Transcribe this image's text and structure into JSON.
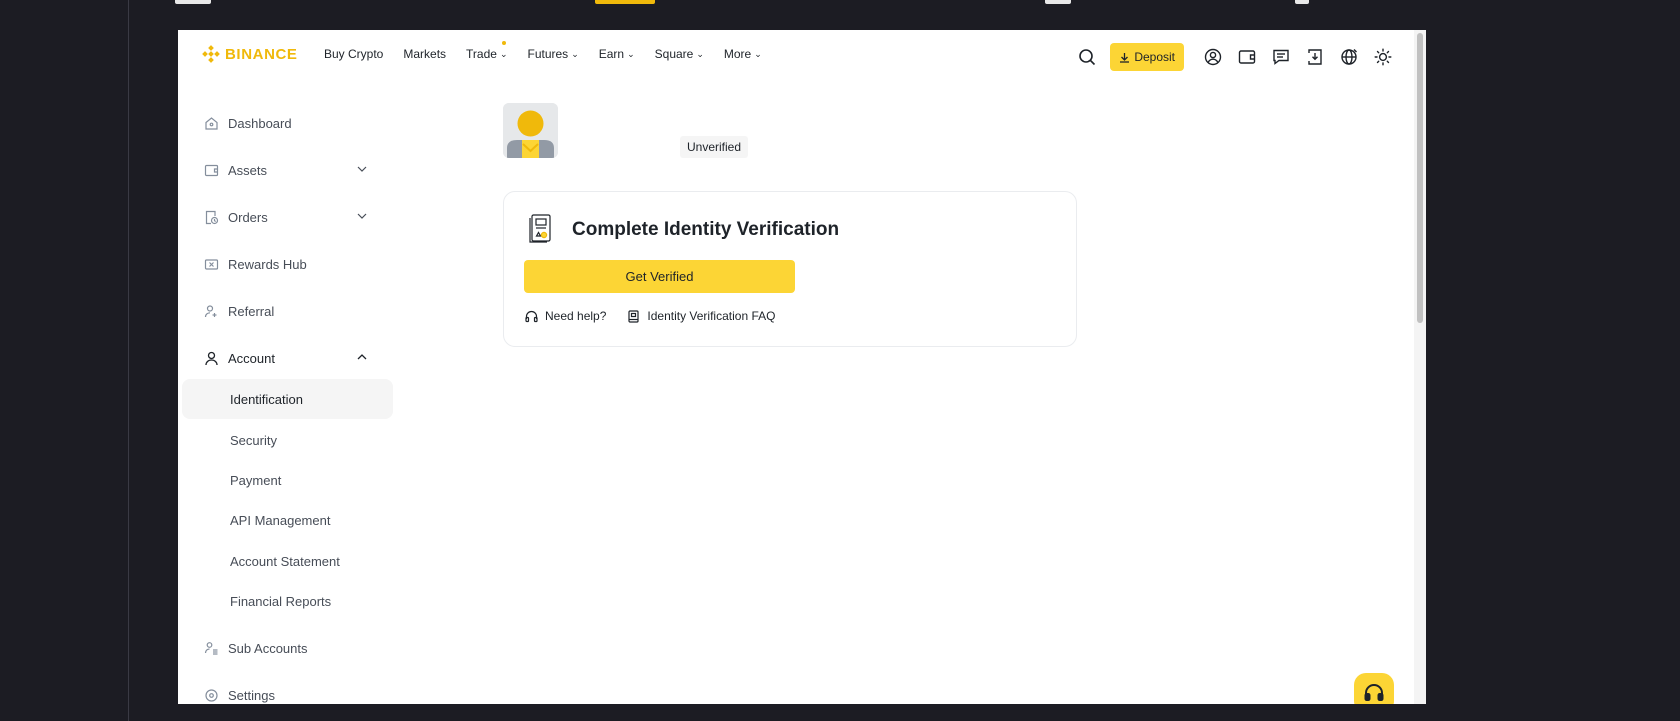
{
  "header": {
    "brand": "BINANCE",
    "nav": [
      {
        "label": "Buy Crypto",
        "chevron": false
      },
      {
        "label": "Markets",
        "chevron": false
      },
      {
        "label": "Trade",
        "chevron": true,
        "dot": true
      },
      {
        "label": "Futures",
        "chevron": true
      },
      {
        "label": "Earn",
        "chevron": true
      },
      {
        "label": "Square",
        "chevron": true
      },
      {
        "label": "More",
        "chevron": true
      }
    ],
    "deposit_label": "Deposit",
    "icons": [
      "search-icon",
      "user-profile-icon",
      "wallet-icon",
      "messages-icon",
      "download-icon",
      "language-globe-icon",
      "theme-sun-icon"
    ]
  },
  "sidebar": {
    "items": [
      {
        "label": "Dashboard",
        "icon": "home-icon"
      },
      {
        "label": "Assets",
        "icon": "wallet-icon",
        "expandable": true
      },
      {
        "label": "Orders",
        "icon": "orders-icon",
        "expandable": true
      },
      {
        "label": "Rewards Hub",
        "icon": "ticket-icon"
      },
      {
        "label": "Referral",
        "icon": "add-user-icon"
      },
      {
        "label": "Account",
        "icon": "person-icon",
        "expanded": true
      },
      {
        "label": "Identification",
        "active": true
      },
      {
        "label": "Security"
      },
      {
        "label": "Payment"
      },
      {
        "label": "API Management"
      },
      {
        "label": "Account Statement"
      },
      {
        "label": "Financial Reports"
      },
      {
        "label": "Sub Accounts",
        "icon": "sub-accounts-icon"
      },
      {
        "label": "Settings",
        "icon": "settings-icon"
      }
    ]
  },
  "profile": {
    "status_badge": "Unverified"
  },
  "verification_card": {
    "title": "Complete Identity Verification",
    "button_label": "Get Verified",
    "help_label": "Need help?",
    "faq_label": "Identity Verification FAQ"
  },
  "colors": {
    "brand_yellow": "#F0B90B",
    "button_yellow": "#FCD535",
    "text_primary": "#1E2329",
    "text_secondary": "#474D57",
    "page_backdrop": "#1C1C23"
  }
}
